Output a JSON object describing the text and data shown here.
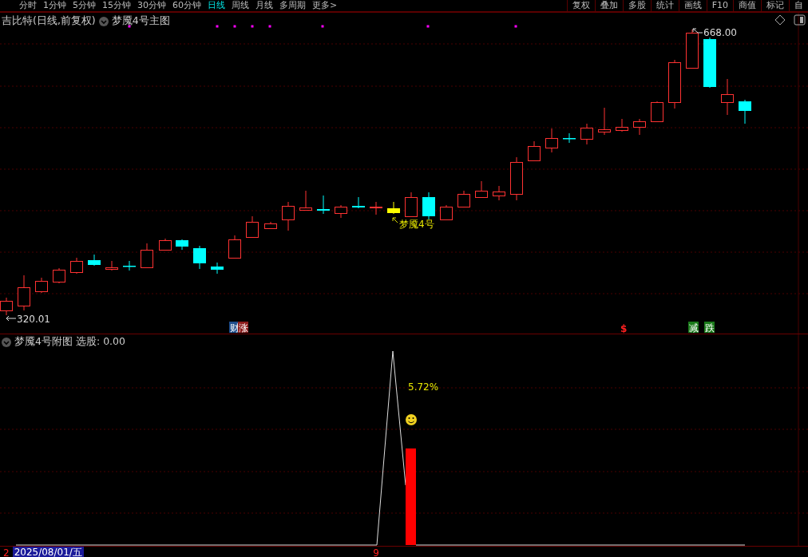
{
  "toolbar": {
    "periods": [
      {
        "label": "分时",
        "selected": false
      },
      {
        "label": "1分钟",
        "selected": false
      },
      {
        "label": "5分钟",
        "selected": false
      },
      {
        "label": "15分钟",
        "selected": false
      },
      {
        "label": "30分钟",
        "selected": false
      },
      {
        "label": "60分钟",
        "selected": false
      },
      {
        "label": "日线",
        "selected": true
      },
      {
        "label": "周线",
        "selected": false
      },
      {
        "label": "月线",
        "selected": false
      },
      {
        "label": "多周期",
        "selected": false
      },
      {
        "label": "更多>",
        "selected": false
      }
    ],
    "tools": [
      "复权",
      "叠加",
      "多股",
      "统计",
      "画线",
      "F10",
      "商值",
      "标记",
      "自"
    ]
  },
  "main_chart": {
    "title": "吉比特(日线,前复权)",
    "indicator": "梦魇4号主图",
    "high_label": "668.00",
    "low_label": "320.01",
    "signal_label": "梦魇4号",
    "markers": [
      {
        "kind": "badge",
        "text": "财",
        "color": "#1f4e8c"
      },
      {
        "kind": "badge",
        "text": "涨",
        "color": "#8c1c1c"
      },
      {
        "kind": "symbol",
        "text": "$",
        "color": "#ff2020"
      },
      {
        "kind": "badge",
        "text": "减",
        "color": "#1a7a1a"
      },
      {
        "kind": "badge",
        "text": "跌",
        "color": "#1a7a1a"
      }
    ]
  },
  "sub_chart": {
    "title": "梦魇4号附图",
    "reading": "选股: 0.00",
    "percent_label": "5.72%"
  },
  "time_axis": {
    "left_mark": "2",
    "date": "2025/08/01/五",
    "right_mark": "9"
  }
}
